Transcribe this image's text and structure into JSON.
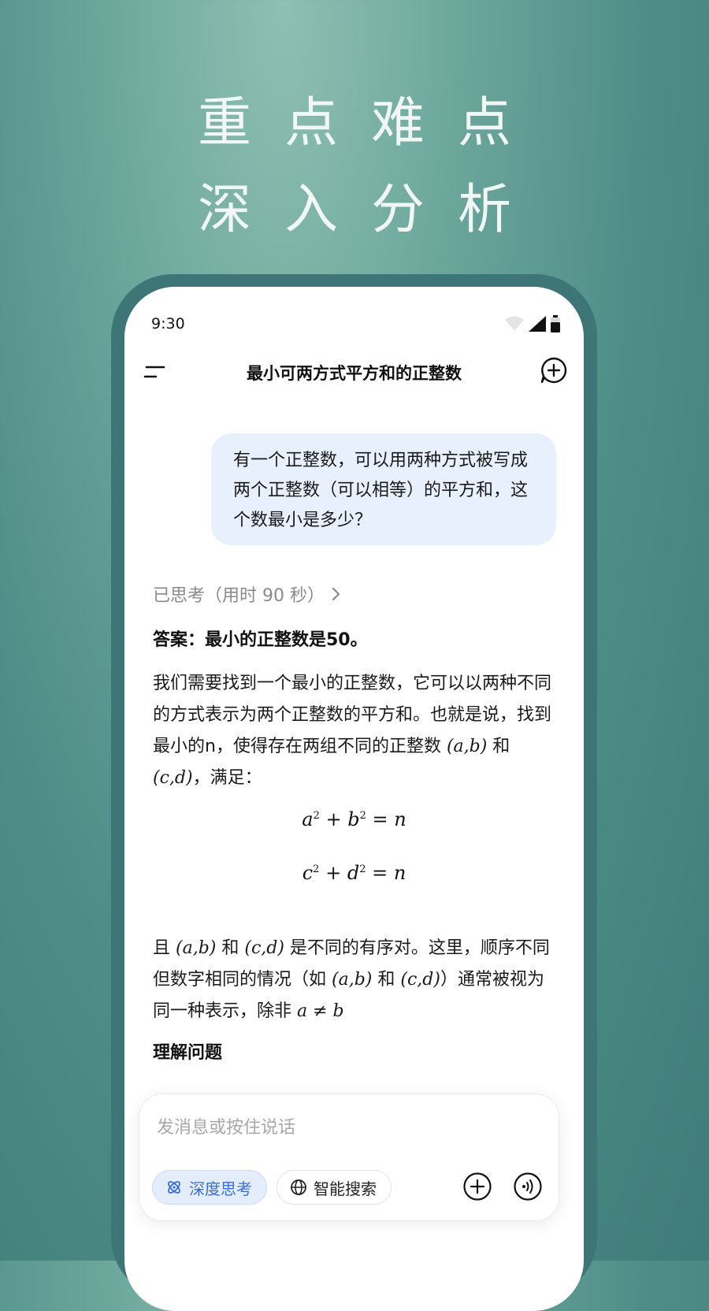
{
  "headline": {
    "line1": "重点难点",
    "line2": "深入分析"
  },
  "status": {
    "time": "9:30"
  },
  "topbar": {
    "title": "最小可两方式平方和的正整数"
  },
  "user_message": {
    "text": "有一个正整数，可以用两种方式被写成两个正整数（可以相等）的平方和，这个数最小是多少？"
  },
  "thinking": {
    "label": "已思考（用时 90 秒）"
  },
  "answer": {
    "text": "答案：最小的正整数是50。"
  },
  "paragraph1": {
    "text": "我们需要找到一个最小的正整数，它可以以两种不同的方式表示为两个正整数的平方和。也就是说，找到最小的n，使得存在两组不同的正整数",
    "pair_ab": "(a,b)",
    "joiner": " 和 ",
    "pair_cd": "(c,d)",
    "tail": "，满足："
  },
  "equations": {
    "eq1": {
      "a": "a",
      "b": "b",
      "rhs": "= n"
    },
    "eq2": {
      "a": "c",
      "b": "d",
      "rhs": "= n"
    },
    "exponent": "2",
    "plus": "+"
  },
  "paragraph2": {
    "prefix": "且 ",
    "pair_ab": "(a,b)",
    "joiner": " 和 ",
    "pair_cd": "(c,d)",
    "middle": " 是不同的有序对。这里，顺序不同但数字相同的情况（如 ",
    "pair_ab2": "(a,b)",
    "joiner2": " 和 ",
    "pair_cd2": "(c,d)",
    "end": "）通常被视为同一种表示，除非 ",
    "cond": "a ≠ b"
  },
  "subheading": {
    "text": "理解问题"
  },
  "input": {
    "placeholder": "发消息或按住说话",
    "deep_think_label": "深度思考",
    "smart_search_label": "智能搜索"
  },
  "icons": {
    "menu": "menu-icon",
    "new_chat": "new-chat-icon",
    "chevron": "chevron-right-icon",
    "deep_think": "atom-icon",
    "search": "globe-icon",
    "plus": "plus-circle-icon",
    "voice": "voice-icon"
  },
  "colors": {
    "accent": "#3b6fd8",
    "bubble": "#e8f0fd",
    "frame": "#3e7576"
  }
}
